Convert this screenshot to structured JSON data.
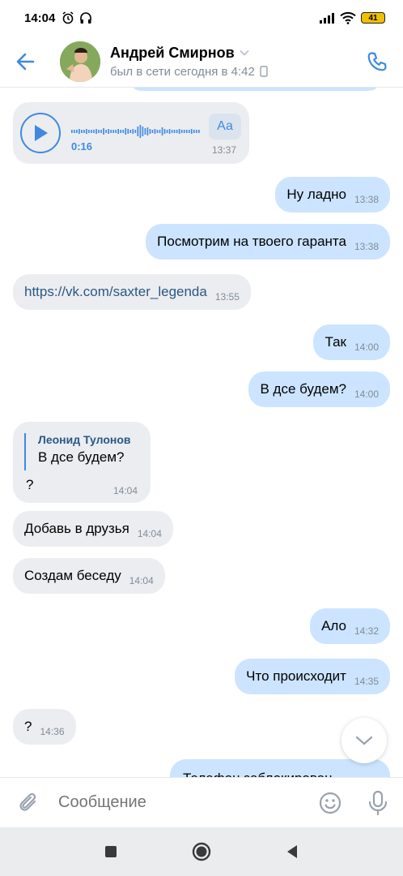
{
  "status_bar": {
    "time": "14:04",
    "battery": "41",
    "icons": [
      "alarm-icon",
      "headphones-icon",
      "signal-icon",
      "wifi-icon",
      "battery-icon"
    ]
  },
  "header": {
    "name": "Андрей Смирнов",
    "status": "был в сети сегодня в 4:42",
    "icons": [
      "back-arrow-icon",
      "chevron-down-icon",
      "phone-icon",
      "mobile-device-icon"
    ]
  },
  "voice_message": {
    "duration": "0:16",
    "transcript_button": "Аа",
    "time": "13:37"
  },
  "messages": [
    {
      "dir": "out",
      "text": "Ну ладно",
      "time": "13:38"
    },
    {
      "dir": "out",
      "text": "Посмотрим на твоего гаранта",
      "time": "13:38"
    },
    {
      "dir": "in",
      "text": "https://vk.com/saxter_legenda",
      "time": "13:55"
    },
    {
      "dir": "out",
      "text": "Так",
      "time": "14:00"
    },
    {
      "dir": "out",
      "text": "В дсе будем?",
      "time": "14:00"
    },
    {
      "dir": "in",
      "text": "Добавь в друзья",
      "time": "14:04"
    },
    {
      "dir": "in",
      "text": "Создам беседу",
      "time": "14:04"
    },
    {
      "dir": "out",
      "text": "Ало",
      "time": "14:32"
    },
    {
      "dir": "out",
      "text": "Что происходит",
      "time": "14:35"
    },
    {
      "dir": "in",
      "text": "?",
      "time": "14:36"
    }
  ],
  "reply_message": {
    "quote_author": "Леонид Тулонов",
    "quote_text": "В дсе будем?",
    "text": "?",
    "time": "14:04"
  },
  "partial_message": {
    "text": "Телефон заблокирован"
  },
  "composer": {
    "placeholder": "Сообщение",
    "icons": [
      "paperclip-icon",
      "emoji-icon",
      "microphone-icon"
    ]
  },
  "navigation": {
    "icons": [
      "recent-apps-icon",
      "home-icon",
      "back-icon"
    ]
  },
  "colors": {
    "accent": "#3f8ae0",
    "incoming_bubble": "#ebedf0",
    "outgoing_bubble": "#cce4ff",
    "link": "#2a5885",
    "secondary_text": "#818c99",
    "battery": "#f0c000"
  }
}
